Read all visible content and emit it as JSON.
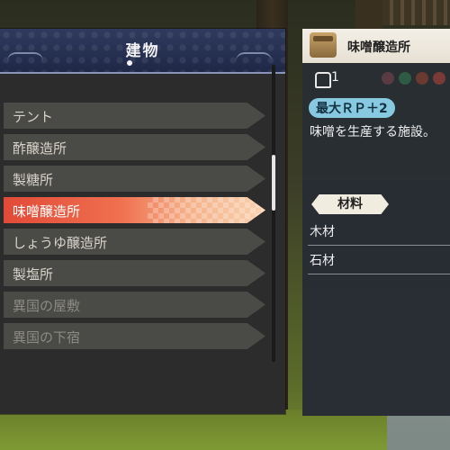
{
  "left_panel": {
    "title": "建物",
    "items": [
      {
        "label": "テント",
        "state": "normal"
      },
      {
        "label": "酢醸造所",
        "state": "normal"
      },
      {
        "label": "製糖所",
        "state": "normal"
      },
      {
        "label": "味噌醸造所",
        "state": "selected"
      },
      {
        "label": "しょうゆ醸造所",
        "state": "normal"
      },
      {
        "label": "製塩所",
        "state": "normal"
      },
      {
        "label": "異国の屋敷",
        "state": "dim"
      },
      {
        "label": "異国の下宿",
        "state": "dim"
      }
    ]
  },
  "detail": {
    "title": "味噌醸造所",
    "count": "1",
    "tag": "最大ＲＰ＋2",
    "description": "味噌を生産する施設。",
    "materials_label": "材料",
    "materials": [
      "木材",
      "石材"
    ]
  },
  "colors": {
    "accent_selected": "#e24a37",
    "header_bg": "#2f3a5e",
    "pill_bg": "#86c9e0"
  },
  "icons": [
    "building-icon",
    "person-icon"
  ]
}
